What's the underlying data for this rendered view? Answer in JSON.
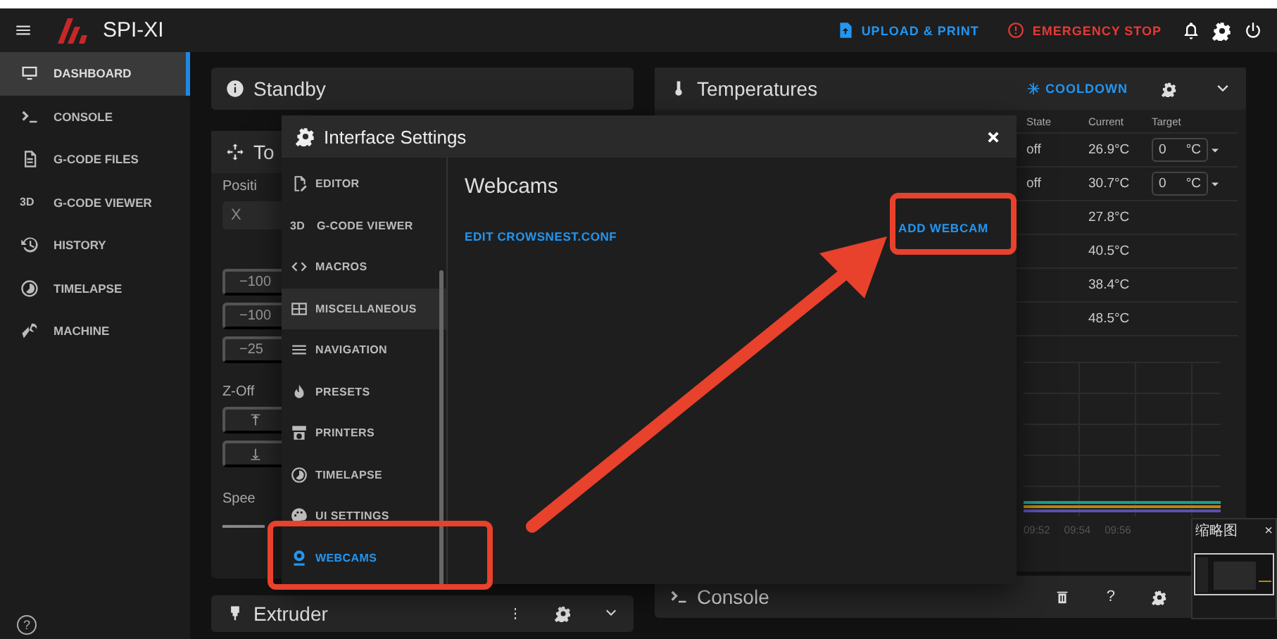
{
  "app": {
    "title": "SPI-XI"
  },
  "topbar": {
    "upload": "UPLOAD & PRINT",
    "emergency": "EMERGENCY STOP"
  },
  "sidebar": {
    "items": [
      {
        "label": "DASHBOARD",
        "selected": true
      },
      {
        "label": "CONSOLE",
        "selected": false
      },
      {
        "label": "G-CODE FILES",
        "selected": false
      },
      {
        "label": "G-CODE VIEWER",
        "icon_text": "3D",
        "selected": false
      },
      {
        "label": "HISTORY",
        "selected": false
      },
      {
        "label": "TIMELAPSE",
        "selected": false
      },
      {
        "label": "MACHINE",
        "selected": false
      }
    ],
    "help": "?"
  },
  "standby": {
    "title": "Standby"
  },
  "toolhead": {
    "title": "To",
    "position_label": "Positi",
    "x_field": "X",
    "moves": [
      "−100",
      "−100",
      "−25"
    ],
    "zoffset_label": "Z-Off",
    "speed_label": "Spee"
  },
  "extruder": {
    "title": "Extruder"
  },
  "temperatures": {
    "title": "Temperatures",
    "cooldown": "COOLDOWN",
    "columns": [
      "State",
      "Current",
      "Target"
    ],
    "rows": [
      {
        "state": "off",
        "current": "26.9°C",
        "target": "0",
        "unit": "°C"
      },
      {
        "state": "off",
        "current": "30.7°C",
        "target": "0",
        "unit": "°C"
      },
      {
        "current": "27.8°C"
      },
      {
        "current": "40.5°C"
      },
      {
        "current": "38.4°C"
      },
      {
        "current": "48.5°C"
      }
    ],
    "time_labels": [
      "09:52",
      "09:54",
      "09:56"
    ]
  },
  "console": {
    "title": "Console",
    "help": "?"
  },
  "dialog": {
    "title": "Interface Settings",
    "nav": [
      {
        "label": "EDITOR",
        "selected": false
      },
      {
        "label": "G-CODE VIEWER",
        "icon_text": "3D",
        "selected": false
      },
      {
        "label": "MACROS",
        "selected": false
      },
      {
        "label": "MISCELLANEOUS",
        "selected": false
      },
      {
        "label": "NAVIGATION",
        "selected": false
      },
      {
        "label": "PRESETS",
        "selected": false
      },
      {
        "label": "PRINTERS",
        "selected": false
      },
      {
        "label": "TIMELAPSE",
        "selected": false
      },
      {
        "label": "UI SETTINGS",
        "selected": false
      },
      {
        "label": "WEBCAMS",
        "selected": true
      }
    ],
    "heading": "Webcams",
    "edit_link": "EDIT CROWSNEST.CONF",
    "add_button": "ADD WEBCAM"
  },
  "thumbnail_popup": {
    "title": "缩略图",
    "close": "×"
  }
}
